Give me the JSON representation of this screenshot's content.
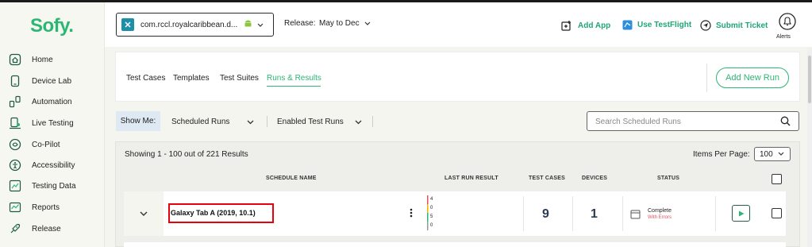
{
  "app": {
    "logo": "Sofy."
  },
  "sidebar": {
    "items": [
      {
        "label": "Home",
        "icon": "home-icon"
      },
      {
        "label": "Device Lab",
        "icon": "device-icon"
      },
      {
        "label": "Automation",
        "icon": "automation-icon"
      },
      {
        "label": "Live Testing",
        "icon": "live-testing-icon"
      },
      {
        "label": "Co-Pilot",
        "icon": "copilot-icon"
      },
      {
        "label": "Accessibility",
        "icon": "accessibility-icon"
      },
      {
        "label": "Testing Data",
        "icon": "testing-data-icon"
      },
      {
        "label": "Reports",
        "icon": "reports-icon"
      },
      {
        "label": "Release",
        "icon": "release-icon"
      }
    ]
  },
  "header": {
    "app_select": "com.rccl.royalcaribbean.d...",
    "release_label": "Release:",
    "release_value": "May to Dec",
    "add_app": "Add App",
    "use_testflight": "Use TestFlight",
    "submit_ticket": "Submit Ticket",
    "alerts": "Alerts"
  },
  "tabs": {
    "items": [
      "Test Cases",
      "Templates",
      "Test Suites",
      "Runs & Results"
    ],
    "active": "Runs & Results",
    "add_new_run": "Add New Run"
  },
  "filters": {
    "show_me": "Show Me:",
    "scheduled": "Scheduled Runs",
    "enabled": "Enabled Test Runs",
    "search_placeholder": "Search Scheduled Runs"
  },
  "results": {
    "showing": "Showing 1 - 100 out of 221 Results",
    "items_per_page_label": "Items Per Page:",
    "items_per_page": "100",
    "columns": {
      "schedule_name": "SCHEDULE NAME",
      "last_run_result": "LAST RUN RESULT",
      "test_cases": "TEST CASES",
      "devices": "DEVICES",
      "status": "STATUS"
    },
    "rows": [
      {
        "name": "Galaxy Tab A (2019, 10.1)",
        "last_run": [
          "4",
          "0",
          "5",
          "0"
        ],
        "test_cases": "9",
        "devices": "1",
        "status": "Complete",
        "status_sub": "With Errors"
      }
    ]
  },
  "colors": {
    "brand": "#2bb673",
    "highlight": "#e8000d",
    "error": "#e8505b"
  }
}
